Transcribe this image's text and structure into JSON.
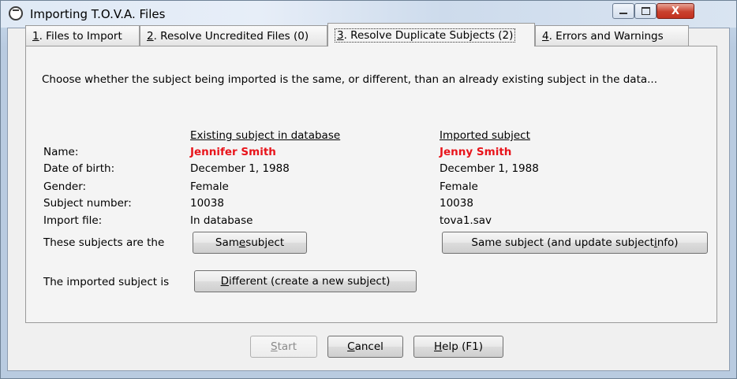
{
  "window": {
    "title": "Importing T.O.V.A. Files",
    "controls": {
      "minimize": "–",
      "maximize": "□",
      "close": "X"
    }
  },
  "tabs": [
    {
      "key": "1",
      "rest": ". Files to Import",
      "active": false
    },
    {
      "key": "2",
      "rest": ". Resolve Uncredited Files (0)",
      "active": false
    },
    {
      "key": "3",
      "rest": ". Resolve Duplicate Subjects (2)",
      "active": true
    },
    {
      "key": "4",
      "rest": ". Errors and Warnings",
      "active": false
    }
  ],
  "panel": {
    "instruction": "Choose whether the subject being imported is the same, or different, than an already existing subject in the data...",
    "existing_header": "Existing subject in database",
    "imported_header": "Imported subject",
    "fields": [
      {
        "label": "Name:",
        "existing": "Jennifer Smith",
        "imported": "Jenny Smith"
      },
      {
        "label": "Date of birth:",
        "existing": "December 1, 1988",
        "imported": "December 1, 1988"
      },
      {
        "label": "Gender:",
        "existing": "Female",
        "imported": "Female"
      },
      {
        "label": "Subject number:",
        "existing": "10038",
        "imported": "10038"
      },
      {
        "label": "Import file:",
        "existing": "In database",
        "imported": "tova1.sav"
      }
    ],
    "same_prompt": "These subjects are the",
    "same_button": {
      "pre": "Sam",
      "key": "e",
      "post": " subject"
    },
    "same_update_button": {
      "pre": "Same subject (and update subject ",
      "key": "i",
      "post": "nfo)"
    },
    "different_prompt": "The imported subject is",
    "different_button": {
      "pre": "",
      "key": "D",
      "post": "ifferent (create a new subject)"
    }
  },
  "footer": {
    "start": {
      "key": "S",
      "post": "tart",
      "enabled": false
    },
    "cancel": {
      "key": "C",
      "post": "ancel"
    },
    "help": {
      "key": "H",
      "post": "elp (F1)"
    }
  },
  "colors": {
    "name_highlight": "#e8141b"
  }
}
